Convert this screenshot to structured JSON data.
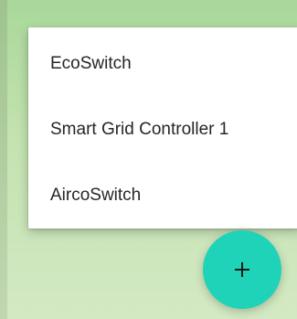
{
  "menu": {
    "items": [
      {
        "label": "EcoSwitch"
      },
      {
        "label": "Smart Grid Controller 1"
      },
      {
        "label": "AircoSwitch"
      }
    ]
  },
  "fab": {
    "icon": "plus-icon"
  },
  "colors": {
    "fab_accent": "#1fd3b9",
    "background_green": "#c4e3b1",
    "menu_background": "#ffffff"
  }
}
